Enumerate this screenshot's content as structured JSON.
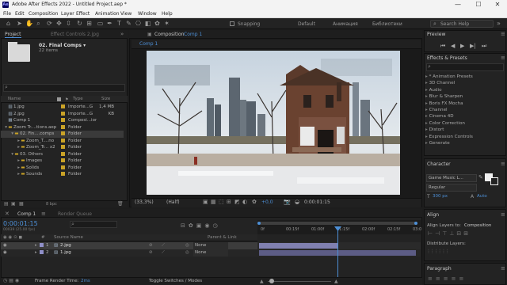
{
  "app": {
    "title": "Adobe After Effects 2022 - Untitled Project.aep *",
    "badge": "Ae"
  },
  "window_controls": {
    "minimize": "—",
    "maximize": "☐",
    "close": "✕"
  },
  "menu": [
    "File",
    "Edit",
    "Composition",
    "Layer",
    "Effect",
    "Animation",
    "View",
    "Window",
    "Help"
  ],
  "toolbar": {
    "snapping_label": "Snapping",
    "workspaces": [
      "Default",
      "Анимация",
      "Библиотеки"
    ],
    "search_placeholder": "Search Help"
  },
  "project_panel": {
    "tab": "Project",
    "tab_effect_controls": "Effect Controls 2.jpg",
    "selected_name": "02. Final Comps ▾",
    "selected_count": "22 items",
    "search_placeholder": "",
    "columns": [
      "Name",
      "Type",
      "Size"
    ],
    "items": [
      {
        "name": "1.jpg",
        "type": "Importe...G",
        "size": "1,4 MB",
        "color": "#c9a227",
        "indent": 0,
        "kind": "file"
      },
      {
        "name": "2.jpg",
        "type": "Importe...G",
        "size": "KB",
        "color": "#c9a227",
        "indent": 0,
        "kind": "file"
      },
      {
        "name": "Comp 1",
        "type": "Composi...ion",
        "size": "",
        "color": "#c9a227",
        "indent": 0,
        "kind": "comp"
      },
      {
        "name": "Zoom Tr....tions.aep",
        "type": "Folder",
        "size": "",
        "color": "#c9a227",
        "indent": 0,
        "kind": "folder"
      },
      {
        "name": "02. Fin....comps",
        "type": "Folder",
        "size": "",
        "color": "#c9a227",
        "indent": 1,
        "kind": "folder"
      },
      {
        "name": "Zoom_T....no",
        "type": "Folder",
        "size": "",
        "color": "#c9a227",
        "indent": 2,
        "kind": "folder"
      },
      {
        "name": "Zoom_Tr... x2",
        "type": "Folder",
        "size": "",
        "color": "#c9a227",
        "indent": 2,
        "kind": "folder"
      },
      {
        "name": "03. Others",
        "type": "Folder",
        "size": "",
        "color": "#c9a227",
        "indent": 1,
        "kind": "folder"
      },
      {
        "name": "Images",
        "type": "Folder",
        "size": "",
        "color": "#c9a227",
        "indent": 2,
        "kind": "folder"
      },
      {
        "name": "Solids",
        "type": "Folder",
        "size": "",
        "color": "#c9a227",
        "indent": 2,
        "kind": "folder"
      },
      {
        "name": "Sounds",
        "type": "Folder",
        "size": "",
        "color": "#c9a227",
        "indent": 2,
        "kind": "folder"
      }
    ],
    "footer_bpc": "8 bpc"
  },
  "composition_panel": {
    "tab": "Composition",
    "tab_comp": "Comp 1",
    "subtab": "Comp 1",
    "zoom": "(33,3%)",
    "resolution": "(Half)",
    "exposure": "+0,0",
    "timecode": "0:00:01:15"
  },
  "preview_panel": {
    "title": "Preview"
  },
  "effects_panel": {
    "title": "Effects & Presets",
    "items": [
      "* Animation Presets",
      "3D Channel",
      "Audio",
      "Blur & Sharpen",
      "Boris FX Mocha",
      "Channel",
      "Cinema 4D",
      "Color Correction",
      "Distort",
      "Expression Controls",
      "Generate"
    ]
  },
  "character_panel": {
    "title": "Character",
    "font": "Game Music L...",
    "style": "Regular",
    "size": "300 px",
    "leading": "Auto"
  },
  "align_panel": {
    "title": "Align",
    "align_to_label": "Align Layers to:",
    "align_to_value": "Composition",
    "distribute_label": "Distribute Layers:"
  },
  "paragraph_panel": {
    "title": "Paragraph"
  },
  "timeline": {
    "tab": "Comp 1",
    "render_queue": "Render Queue",
    "timecode": "0:00:01:15",
    "frame_info": "00039 (25.00 fps)",
    "columns": [
      "#",
      "Source Name",
      "Parent & Link"
    ],
    "layers": [
      {
        "num": "1",
        "name": "2.jpg",
        "parent": "None"
      },
      {
        "num": "2",
        "name": "1.jpg",
        "parent": "None"
      }
    ],
    "ruler": [
      "0f",
      "00:15f",
      "01:00f",
      "01:15f",
      "02:00f",
      "02:15f",
      "03:0"
    ],
    "footer_render": "Frame Render Time:",
    "footer_render_value": "2ms",
    "toggle_label": "Toggle Switches / Modes"
  },
  "colors": {
    "accent": "#4d8fd6",
    "label_yellow": "#c9a227",
    "clip_purple": "#8f8fc8",
    "playhead": "#4d8fd6"
  }
}
